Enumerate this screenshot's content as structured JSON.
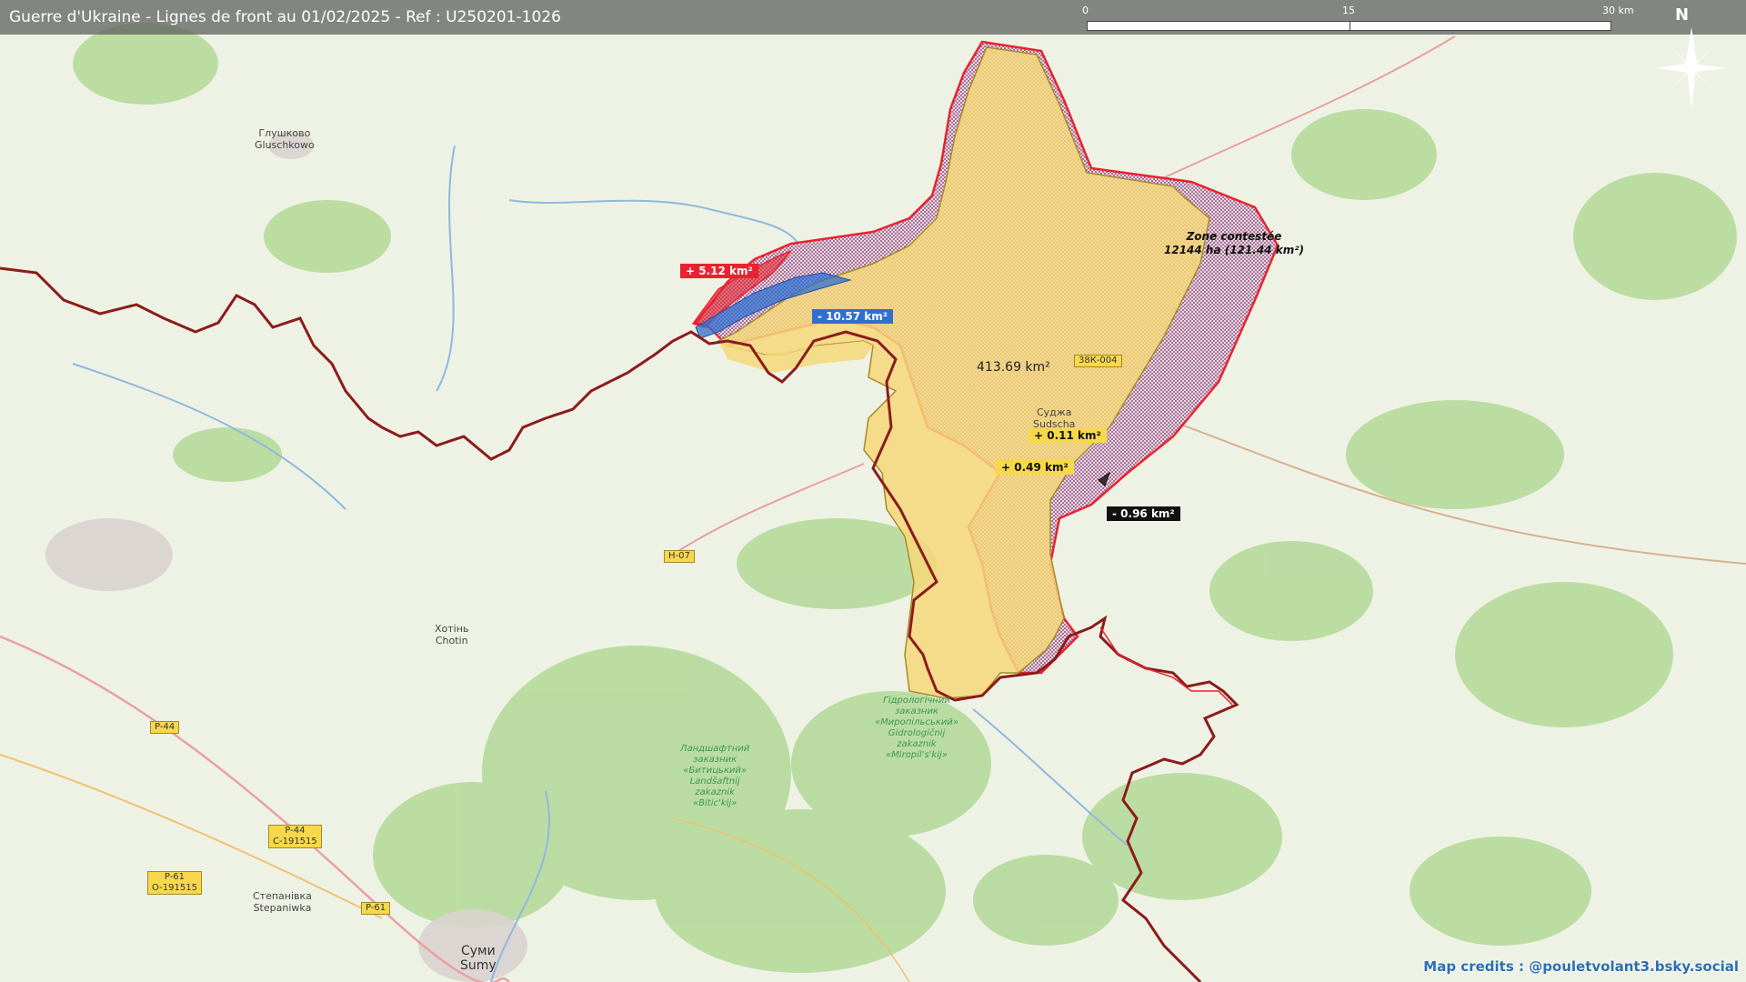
{
  "title": "Guerre d'Ukraine - Lignes de front au 01/02/2025 - Ref : U250201-1026",
  "scale": {
    "tick0": "0",
    "tick1": "15",
    "tick2": "30 km"
  },
  "north": "N",
  "colors": {
    "occupied_fill": "#f6d87a",
    "contested_hatch": "#8a3a6a",
    "frontline": "#e8232f",
    "border": "#8b1c1c",
    "gain_red": "#e8232f",
    "loss_blue": "#2f6fd0",
    "gain_yellow": "#f7d84a",
    "loss_black": "#111111"
  },
  "area_label": "413.69 km²",
  "zone": {
    "line1": "Zone contestée",
    "line2": "12144 ha (121.44 km²)"
  },
  "changes": {
    "red_gain": "+ 5.12 km²",
    "blue_loss": "- 10.57 km²",
    "yellow_gain_1": "+ 0.11 km²",
    "yellow_gain_2": "+ 0.49 km²",
    "black_loss": "- 0.96 km²"
  },
  "places": {
    "glushkovo_1": "Глушково",
    "glushkovo_2": "Gluschkowo",
    "sudzha_1": "Суджа",
    "sudzha_2": "Sudscha",
    "khotin_1": "Хотінь",
    "khotin_2": "Chotin",
    "sumy_1": "Суми",
    "sumy_2": "Sumy",
    "stepanivka_1": "Степанівка",
    "stepanivka_2": "Stepaniwka"
  },
  "roads": {
    "r38k004": "38К-004",
    "h07": "H-07",
    "p44": "P-44",
    "p44b_1": "P-44",
    "p44b_2": "C-191515",
    "p61": "P-61",
    "p61b_1": "P-61",
    "p61b_2": "O-191515"
  },
  "reserves": {
    "mirop_1": "Гідрологічний",
    "mirop_2": "заказник",
    "mirop_3": "«Миропільський»",
    "mirop_4": "Gidrologičnij",
    "mirop_5": "zakaznik",
    "mirop_6": "«Miropil's'kij»",
    "bitic_1": "Ландшафтний",
    "bitic_2": "заказник",
    "bitic_3": "«Битицький»",
    "bitic_4": "Landšaftnij",
    "bitic_5": "zakaznik",
    "bitic_6": "«Bitic'kij»"
  },
  "credits": "Map credits : @pouletvolant3.bsky.social"
}
